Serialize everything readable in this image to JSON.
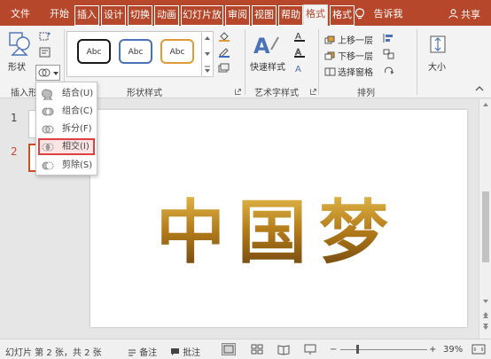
{
  "tabs": [
    "文件",
    "开始",
    "插入",
    "设计",
    "切换",
    "动画",
    "幻灯片放",
    "审阅",
    "视图",
    "帮助",
    "格式",
    "格式"
  ],
  "tell_me": "告诉我",
  "share": "共享",
  "ribbon": {
    "shape_label": "形状",
    "insert_shape_group": "插入形状",
    "style_boxes": [
      "Abc",
      "Abc",
      "Abc"
    ],
    "style_colors": [
      "#1a1a1a",
      "#4a72b8",
      "#e09a3a"
    ],
    "shape_styles_group": "形状样式",
    "quick_styles": "快速样式",
    "wordart_group": "艺术字样式",
    "bring_forward": "上移一层",
    "send_backward": "下移一层",
    "selection_pane": "选择窗格",
    "arrange_group": "排列",
    "size": "大小"
  },
  "merge_menu": {
    "items": [
      "结合(U)",
      "组合(C)",
      "拆分(F)",
      "相交(I)",
      "剪除(S)"
    ],
    "highlighted": "相交(I)"
  },
  "slides_pane": {
    "numbers": [
      "1",
      "2"
    ]
  },
  "slide_text": "中国梦",
  "status": {
    "slide_info": "幻灯片 第 2 张，共 2 张",
    "notes": "备注",
    "comments": "批注",
    "zoom": "39%"
  },
  "colors": {
    "accent": "#b7472a",
    "gold": "#c8941e",
    "highlight_border": "#e04040"
  }
}
